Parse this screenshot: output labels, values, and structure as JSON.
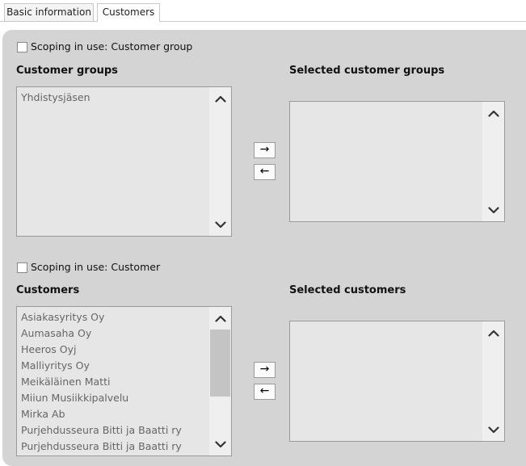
{
  "tabs": [
    {
      "label": "Basic information",
      "active": false
    },
    {
      "label": "Customers",
      "active": true
    }
  ],
  "customer_group_scope": {
    "checkbox_label": "Scoping in use: Customer group",
    "checked": false,
    "available_heading": "Customer groups",
    "selected_heading": "Selected customer groups",
    "available_items": [
      "Yhdistysjäsen"
    ],
    "selected_items": []
  },
  "customer_scope": {
    "checkbox_label": "Scoping in use: Customer",
    "checked": false,
    "available_heading": "Customers",
    "selected_heading": "Selected customers",
    "available_items": [
      "Asiakasyritys Oy",
      "Aumasaha Oy",
      "Heeros Oyj",
      "Malliyritys Oy",
      "Meikäläinen Matti",
      "Miiun Musiikkipalvelu",
      "Mirka Ab",
      "Purjehdusseura Bitti ja Baatti ry",
      "Purjehdusseura Bitti ja Baatti ry"
    ],
    "selected_items": []
  },
  "buttons": {
    "add_label": "→",
    "remove_label": "←"
  },
  "icons": {
    "scroll_up": "chevron-up-icon",
    "scroll_down": "chevron-down-icon"
  }
}
